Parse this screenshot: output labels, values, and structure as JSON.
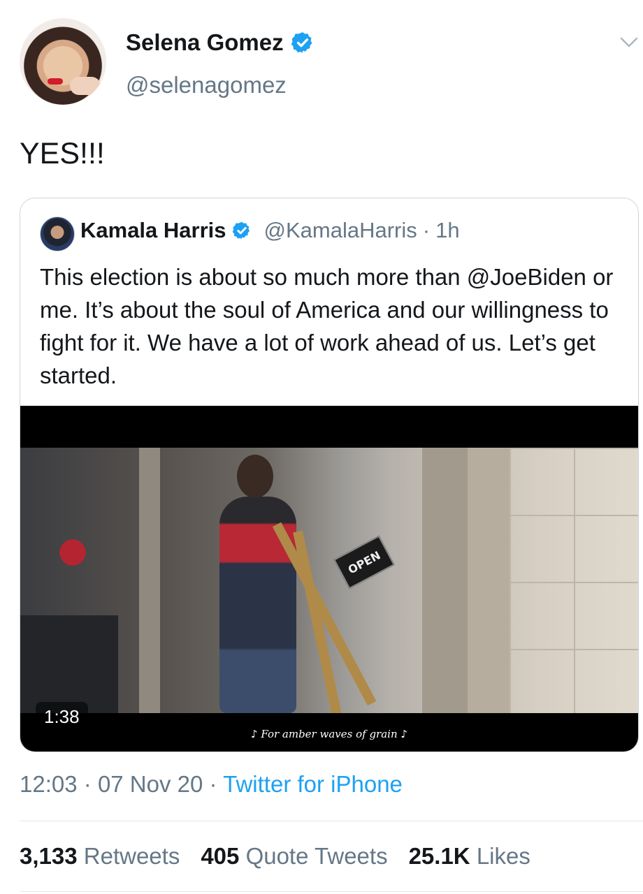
{
  "author": {
    "display_name": "Selena Gomez",
    "handle": "@selenagomez",
    "verified": true
  },
  "tweet": {
    "text": "YES!!!"
  },
  "quoted_tweet": {
    "display_name": "Kamala Harris",
    "handle": "@KamalaHarris",
    "separator": "·",
    "time": "1h",
    "verified": true,
    "text": "This election is about so much more than @JoeBiden or me. It’s about the soul of America and our willingness to fight for it. We have a lot of work ahead of us. Let’s get started.",
    "video": {
      "duration": "1:38",
      "caption": "♪ For amber waves of grain ♪",
      "sign_text": "OPEN"
    }
  },
  "meta": {
    "time": "12:03",
    "sep1": "·",
    "date": "07 Nov 20",
    "sep2": "·",
    "source": "Twitter for iPhone"
  },
  "stats": {
    "retweets_count": "3,133",
    "retweets_label": "Retweets",
    "quotes_count": "405",
    "quotes_label": "Quote Tweets",
    "likes_count": "25.1K",
    "likes_label": "Likes"
  },
  "colors": {
    "verified": "#1da1f2",
    "secondary_text": "#657786",
    "link": "#1da1f2"
  }
}
